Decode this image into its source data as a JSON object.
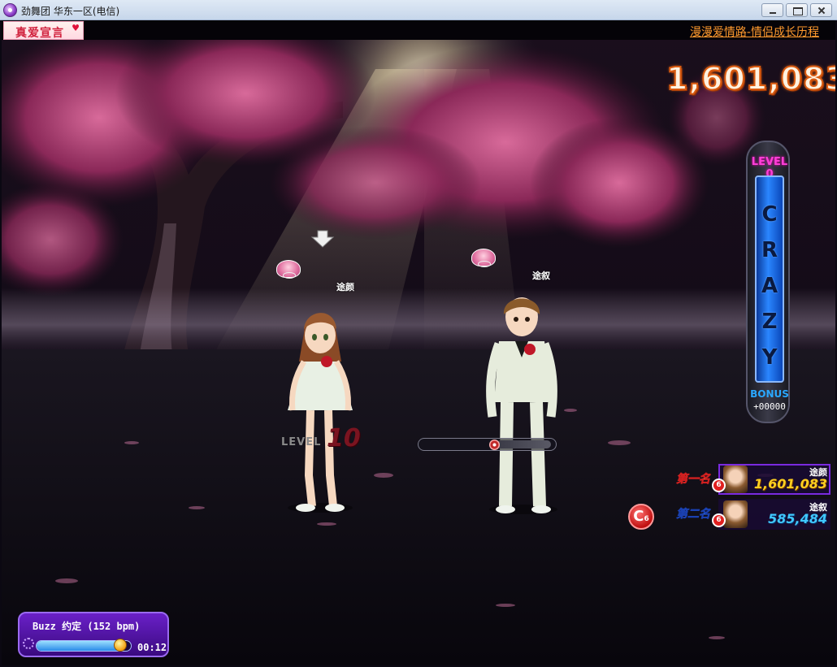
{
  "window": {
    "title": "劲舞团 华东一区(电信)"
  },
  "header": {
    "promo_badge": "真爱宣言",
    "link_text": "漫漫爱情路-情侣成长历程"
  },
  "hud": {
    "score": "1,601,083",
    "level_label": "LEVEL",
    "level_value": "10",
    "hit_progress": 0.56
  },
  "crazy_meter": {
    "level": "LEVEL 0",
    "letters": "CRAZY",
    "bonus_label": "BONUS",
    "bonus_value": "+00000"
  },
  "players": [
    {
      "name": "途颜"
    },
    {
      "name": "途叙"
    }
  ],
  "rankings": [
    {
      "place_label": "第一名",
      "level": "6",
      "name": "途颜",
      "score": "1,601,083"
    },
    {
      "place_label": "第二名",
      "level": "6",
      "name": "途叙",
      "score": "585,484"
    }
  ],
  "combo": {
    "letter": "C",
    "count": "6"
  },
  "music": {
    "title": "Buzz 约定 (152 bpm)",
    "time": "00:12",
    "progress": 0.88
  },
  "colors": {
    "score_fill": "#fff2e0",
    "score_outline": "#d85a10",
    "meter_blue": "#2a86ff",
    "first_place": "#ffd020",
    "second_place": "#40c8ff",
    "link_orange": "#ff9a2e"
  }
}
